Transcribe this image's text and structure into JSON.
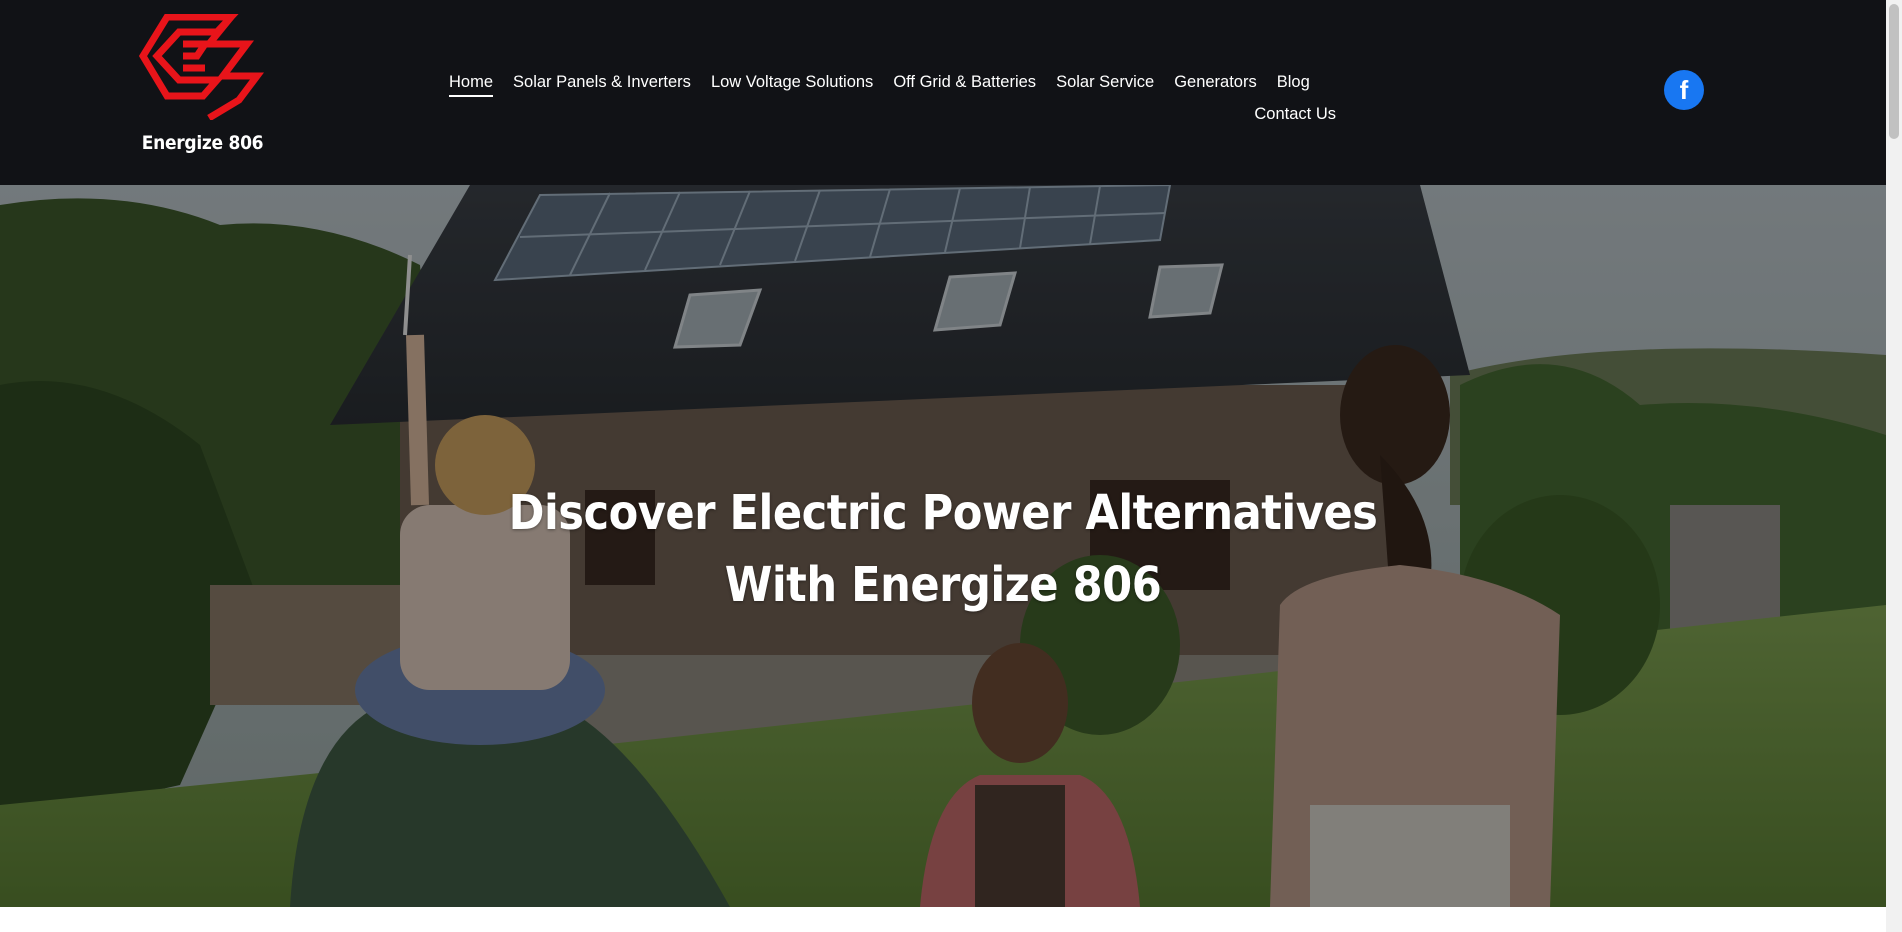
{
  "brand": {
    "name": "Energize 806",
    "logo_color": "#e8141a"
  },
  "nav": {
    "items": [
      {
        "label": "Home",
        "active": true
      },
      {
        "label": "Solar Panels & Inverters"
      },
      {
        "label": "Low Voltage Solutions"
      },
      {
        "label": "Off Grid & Batteries"
      },
      {
        "label": "Solar Service"
      },
      {
        "label": "Generators"
      },
      {
        "label": "Blog"
      },
      {
        "label": "Contact Us"
      }
    ]
  },
  "social": {
    "facebook_icon": "facebook-icon",
    "facebook_color": "#1877f2",
    "facebook_glyph": "f"
  },
  "hero": {
    "title_line1": "Discover Electric Power Alternatives",
    "title_line2": "With Energize 806",
    "image": "family-walking-toward-house-with-solar-panels"
  },
  "colors": {
    "header_bg": "#111216",
    "text": "#ffffff"
  }
}
